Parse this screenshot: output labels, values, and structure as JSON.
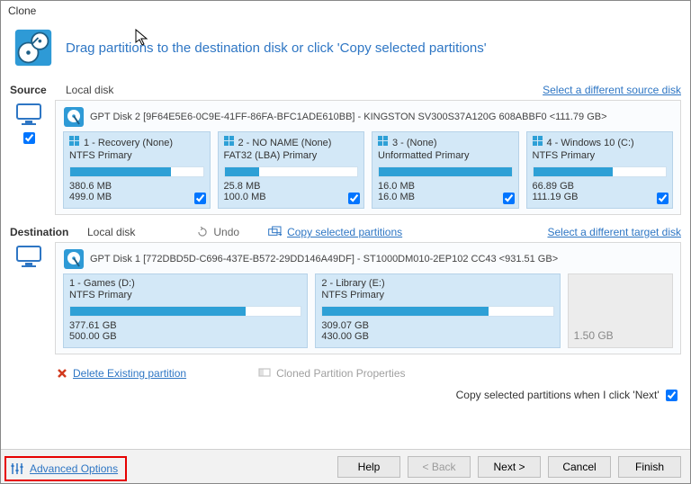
{
  "window": {
    "title": "Clone"
  },
  "hero": {
    "text": "Drag partitions to the destination disk or click 'Copy selected partitions'"
  },
  "source": {
    "label": "Source",
    "local": "Local disk",
    "select_link": "Select a different source disk",
    "disk_line": "GPT Disk 2 [9F64E5E6-0C9E-41FF-86FA-BFC1ADE610BB] - KINGSTON SV300S37A120G 608ABBF0  <111.79 GB>",
    "partitions": [
      {
        "name": "1 - Recovery (None)",
        "fs": "NTFS Primary",
        "used": "380.6 MB",
        "total": "499.0 MB",
        "fill": 76
      },
      {
        "name": "2 - NO NAME (None)",
        "fs": "FAT32 (LBA) Primary",
        "used": "25.8 MB",
        "total": "100.0 MB",
        "fill": 26
      },
      {
        "name": "3 -  (None)",
        "fs": "Unformatted Primary",
        "used": "16.0 MB",
        "total": "16.0 MB",
        "fill": 100
      },
      {
        "name": "4 - Windows 10 (C:)",
        "fs": "NTFS Primary",
        "used": "66.89 GB",
        "total": "111.19 GB",
        "fill": 60
      }
    ]
  },
  "dest": {
    "label": "Destination",
    "local": "Local disk",
    "undo": "Undo",
    "copy_link": "Copy selected partitions",
    "select_link": "Select a different target disk",
    "disk_line": "GPT Disk 1 [772DBD5D-C696-437E-B572-29DD146A49DF] - ST1000DM010-2EP102 CC43  <931.51 GB>",
    "partitions": [
      {
        "name": "1 - Games (D:)",
        "fs": "NTFS Primary",
        "used": "377.61 GB",
        "total": "500.00 GB",
        "fill": 76
      },
      {
        "name": "2 - Library (E:)",
        "fs": "NTFS Primary",
        "used": "309.07 GB",
        "total": "430.00 GB",
        "fill": 72
      }
    ],
    "unalloc": "1.50 GB"
  },
  "actions": {
    "delete": "Delete Existing partition",
    "cloned_props": "Cloned Partition Properties",
    "copy_note": "Copy selected partitions when I click 'Next'"
  },
  "footer": {
    "advanced": "Advanced Options",
    "help": "Help",
    "back": "< Back",
    "next": "Next >",
    "cancel": "Cancel",
    "finish": "Finish"
  }
}
